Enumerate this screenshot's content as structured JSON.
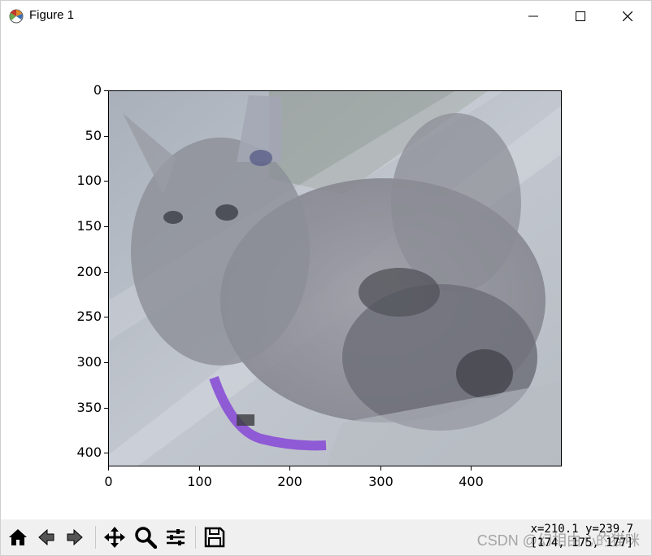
{
  "window": {
    "title": "Figure 1",
    "app_icon": "matplotlib-icon",
    "controls": [
      "minimize-icon",
      "maximize-icon",
      "close-icon"
    ]
  },
  "figure": {
    "image_description_shown": true,
    "y_ticks": [
      "0",
      "50",
      "100",
      "150",
      "200",
      "250",
      "300",
      "350",
      "400"
    ],
    "x_ticks": [
      "0",
      "100",
      "200",
      "300",
      "400"
    ],
    "y_tick_values": [
      0,
      50,
      100,
      150,
      200,
      250,
      300,
      350,
      400
    ],
    "x_tick_values": [
      0,
      100,
      200,
      300,
      400
    ],
    "x_range": [
      0,
      500
    ],
    "y_range": [
      0,
      415
    ]
  },
  "toolbar": {
    "buttons": [
      "home-icon",
      "back-icon",
      "forward-icon",
      "pan-icon",
      "zoom-icon",
      "configure-subplots-icon",
      "save-icon"
    ]
  },
  "status": {
    "coords_line1": "x=210.1 y=239.7",
    "coords_line2": "[174, 175, 177]",
    "watermark": "CSDN @幻相由心的猫咪"
  },
  "colors": {
    "toolbar_bg": "#f0f0f0",
    "collar": "#8a4fd6"
  }
}
